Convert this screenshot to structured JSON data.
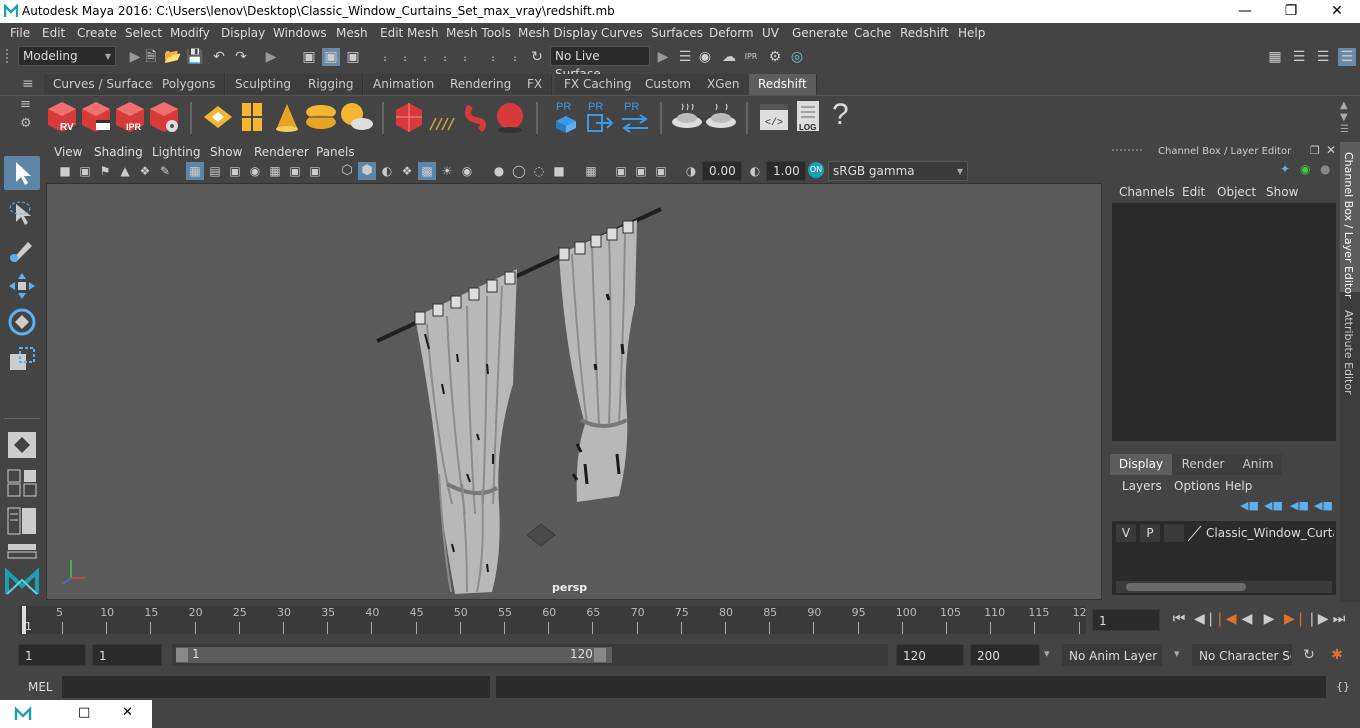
{
  "window": {
    "title": "Autodesk Maya 2016: C:\\Users\\lenov\\Desktop\\Classic_Window_Curtains_Set_max_vray\\redshift.mb"
  },
  "menubar": [
    "File",
    "Edit",
    "Create",
    "Select",
    "Modify",
    "Display",
    "Windows",
    "Mesh",
    "Edit Mesh",
    "Mesh Tools",
    "Mesh Display",
    "Curves",
    "Surfaces",
    "Deform",
    "UV",
    "Generate",
    "Cache",
    "Redshift",
    "Help"
  ],
  "statusline": {
    "mode": "Modeling",
    "live_surface": "No Live Surface"
  },
  "shelf_tabs": [
    "Curves / Surfaces",
    "Polygons",
    "Sculpting",
    "Rigging",
    "Animation",
    "Rendering",
    "FX",
    "FX Caching",
    "Custom",
    "XGen",
    "Redshift"
  ],
  "shelf_active": "Redshift",
  "shelf_icons": {
    "rv": "RV",
    "ipr": "IPR",
    "pr1": "PR",
    "pr2": "PR",
    "pr3": "PR",
    "log": "LOG",
    "help": "?"
  },
  "panel_menu": [
    "View",
    "Shading",
    "Lighting",
    "Show",
    "Renderer",
    "Panels"
  ],
  "view_toolbar": {
    "exposure": "0.00",
    "gamma": "1.00",
    "colorspace": "sRGB gamma"
  },
  "viewport": {
    "camera_label": "persp"
  },
  "channel_box": {
    "title": "Channel Box / Layer Editor",
    "menu": [
      "Channels",
      "Edit",
      "Object",
      "Show"
    ],
    "layer_tabs": [
      "Display",
      "Render",
      "Anim"
    ],
    "layer_tab_active": "Display",
    "layer_menu": [
      "Layers",
      "Options",
      "Help"
    ],
    "layer_row": {
      "v": "V",
      "p": "P",
      "name": "Classic_Window_Curtain"
    }
  },
  "side_tabs": [
    "Channel Box / Layer Editor",
    "Attribute Editor"
  ],
  "timeline": {
    "ticks": [
      "5",
      "10",
      "15",
      "20",
      "25",
      "30",
      "35",
      "40",
      "45",
      "50",
      "55",
      "60",
      "65",
      "70",
      "75",
      "80",
      "85",
      "90",
      "95",
      "100",
      "105",
      "110",
      "115",
      "12"
    ],
    "start_marker": "1",
    "current_frame": "1"
  },
  "range": {
    "start": "1",
    "inner_start": "1",
    "slider_start": "1",
    "slider_end": "120",
    "end": "120",
    "max_end": "200",
    "anim_layer": "No Anim Layer",
    "char_set": "No Character Set"
  },
  "cmdline": {
    "label": "MEL"
  }
}
